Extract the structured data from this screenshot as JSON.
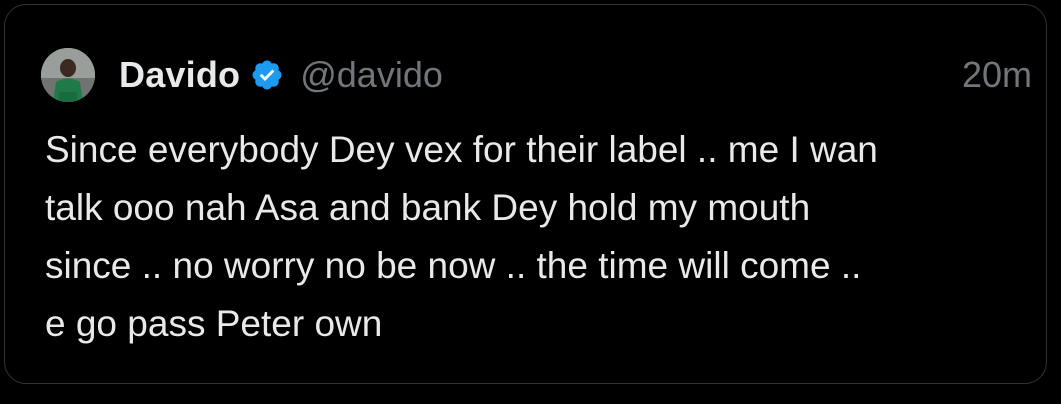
{
  "tweet": {
    "author": {
      "display_name": "Davido",
      "handle": "@davido",
      "verified": true,
      "avatar_icon": "profile-photo"
    },
    "timestamp": "20m",
    "text_lines": [
      "Since everybody Dey vex for their label .. me I wan",
      "talk ooo nah Asa and bank Dey hold my mouth",
      "since .. no worry no be now .. the time will come ..",
      "e go pass Peter own"
    ]
  },
  "colors": {
    "background": "#000000",
    "text_primary": "#e7e9ea",
    "text_secondary": "#71767b",
    "verified_badge": "#1d9bf0",
    "border": "#2f3336"
  }
}
